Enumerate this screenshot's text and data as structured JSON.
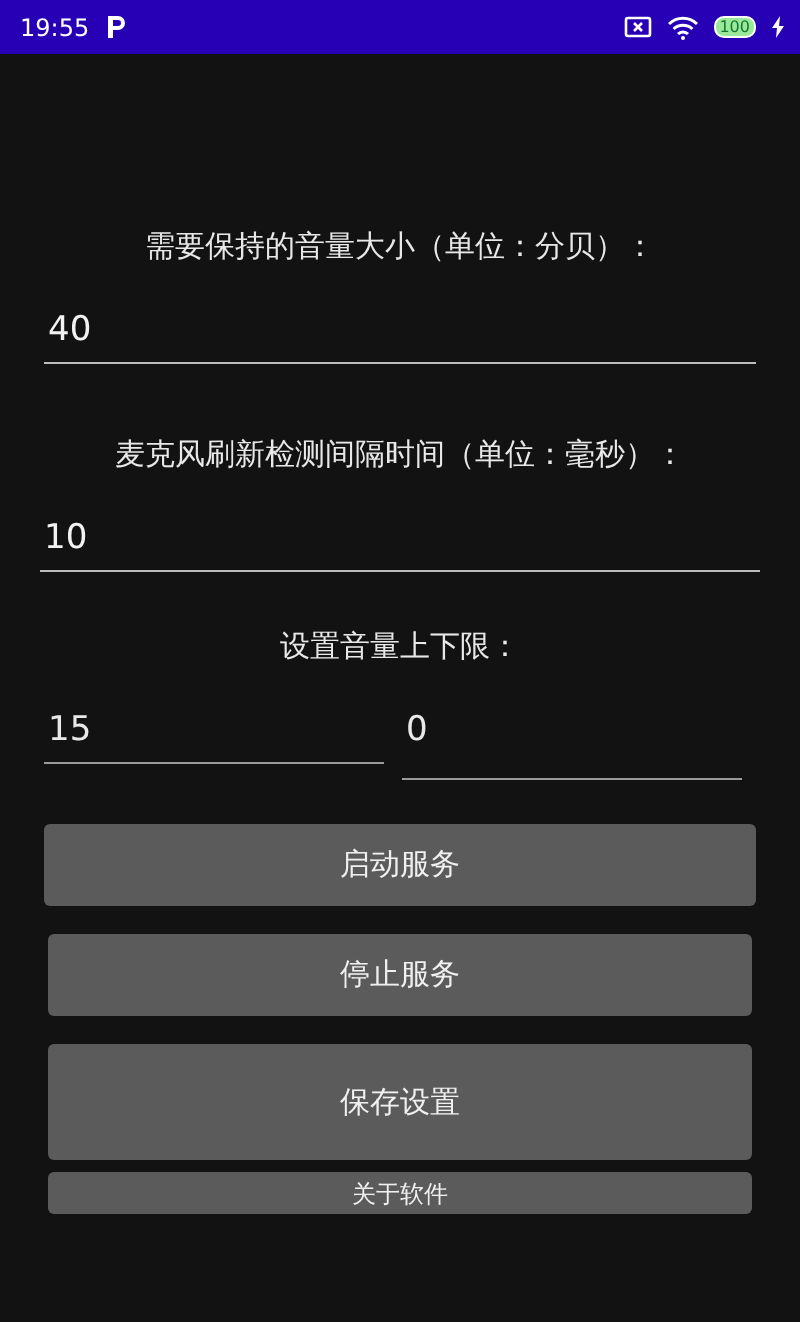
{
  "status_bar": {
    "time": "19:55",
    "battery": "100"
  },
  "fields": [
    {
      "label": "需要保持的音量大小（单位：分贝）：",
      "value": "40"
    },
    {
      "label": "麦克风刷新检测间隔时间（单位：毫秒）：",
      "value": "10"
    }
  ],
  "range": {
    "label": "设置音量上下限：",
    "upper": "15",
    "lower": "0"
  },
  "buttons": [
    "启动服务",
    "停止服务",
    "保存设置",
    "关于软件"
  ]
}
